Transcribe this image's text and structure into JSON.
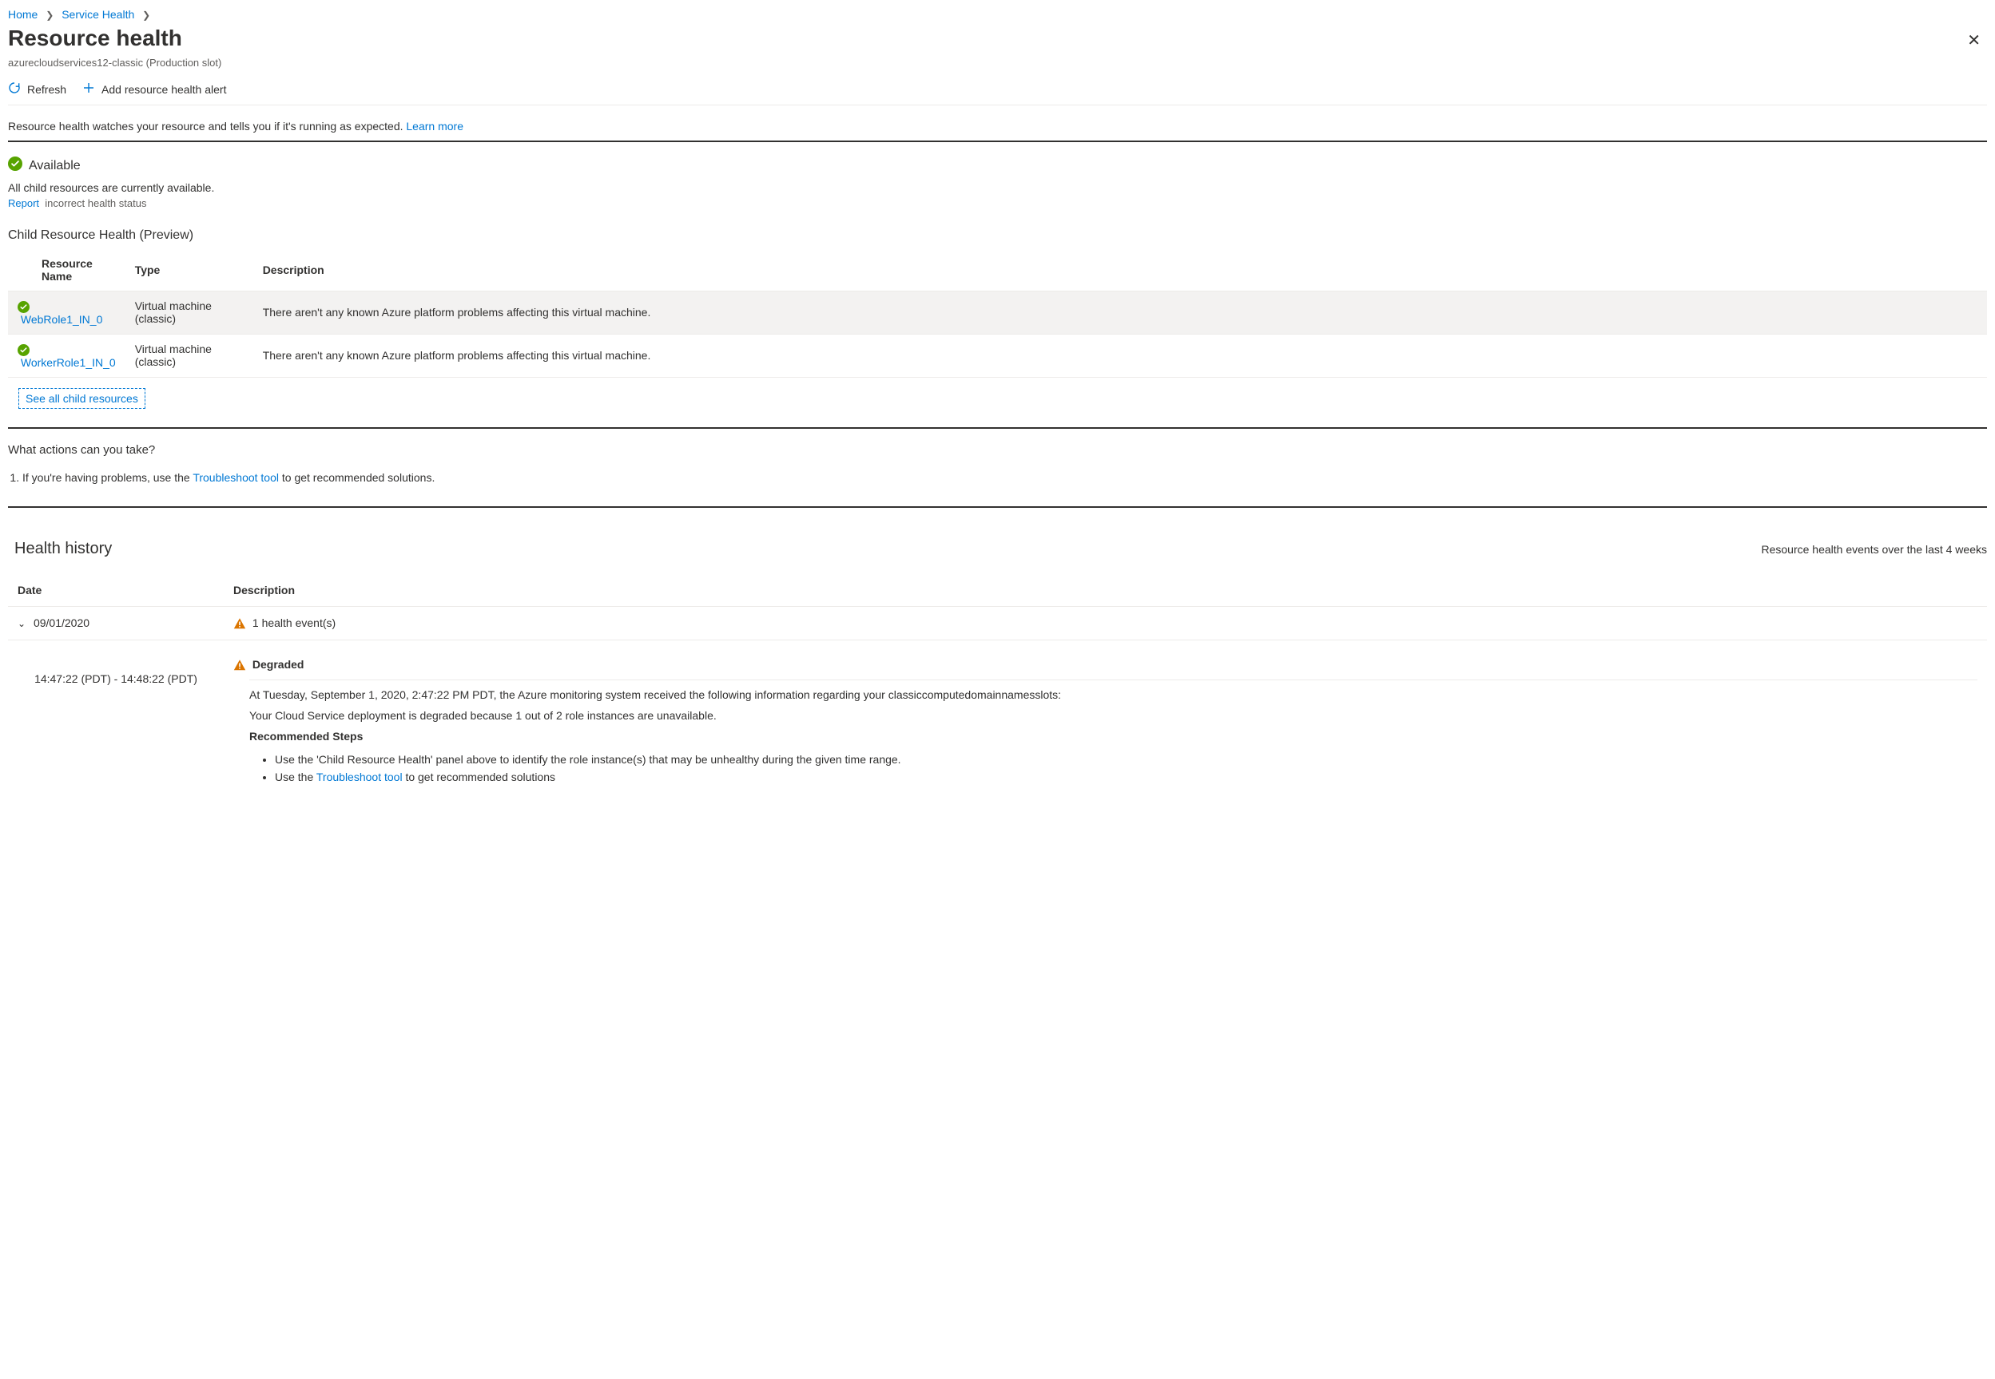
{
  "breadcrumb": [
    {
      "label": "Home"
    },
    {
      "label": "Service Health"
    }
  ],
  "header": {
    "title": "Resource health",
    "subtitle": "azurecloudservices12-classic (Production slot)",
    "close_icon": "close-icon"
  },
  "toolbar": {
    "refresh_label": "Refresh",
    "add_alert_label": "Add resource health alert"
  },
  "intro": {
    "text": "Resource health watches your resource and tells you if it's running as expected.",
    "learn_more": "Learn more"
  },
  "status": {
    "state": "Available",
    "message": "All child resources are currently available.",
    "report_link": "Report",
    "report_tail": "incorrect health status"
  },
  "child_resources": {
    "heading": "Child Resource Health (Preview)",
    "columns": [
      "Resource Name",
      "Type",
      "Description"
    ],
    "rows": [
      {
        "name": "WebRole1_IN_0",
        "type": "Virtual machine (classic)",
        "desc": "There aren't any known Azure platform problems affecting this virtual machine."
      },
      {
        "name": "WorkerRole1_IN_0",
        "type": "Virtual machine (classic)",
        "desc": "There aren't any known Azure platform problems affecting this virtual machine."
      }
    ],
    "see_all": "See all child resources"
  },
  "actions": {
    "question": "What actions can you take?",
    "items_pre": "If you're having problems, use the",
    "items_link": "Troubleshoot tool",
    "items_post": "to get recommended solutions."
  },
  "history": {
    "title": "Health history",
    "subtitle": "Resource health events over the last 4 weeks",
    "columns": {
      "date": "Date",
      "desc": "Description"
    },
    "event": {
      "date": "09/01/2020",
      "summary": "1 health event(s)",
      "time_range": "14:47:22 (PDT) - 14:48:22 (PDT)",
      "degraded_label": "Degraded",
      "line1": "At Tuesday, September 1, 2020, 2:47:22 PM PDT, the Azure monitoring system received the following information regarding your classiccomputedomainnamesslots:",
      "line2": "Your Cloud Service deployment is degraded because 1 out of 2 role instances are unavailable.",
      "rec_steps_label": "Recommended Steps",
      "step1": "Use the 'Child Resource Health' panel above to identify the role instance(s) that may be unhealthy during the given time range.",
      "step2_pre": "Use the",
      "step2_link": "Troubleshoot tool",
      "step2_post": "to get recommended solutions"
    }
  }
}
